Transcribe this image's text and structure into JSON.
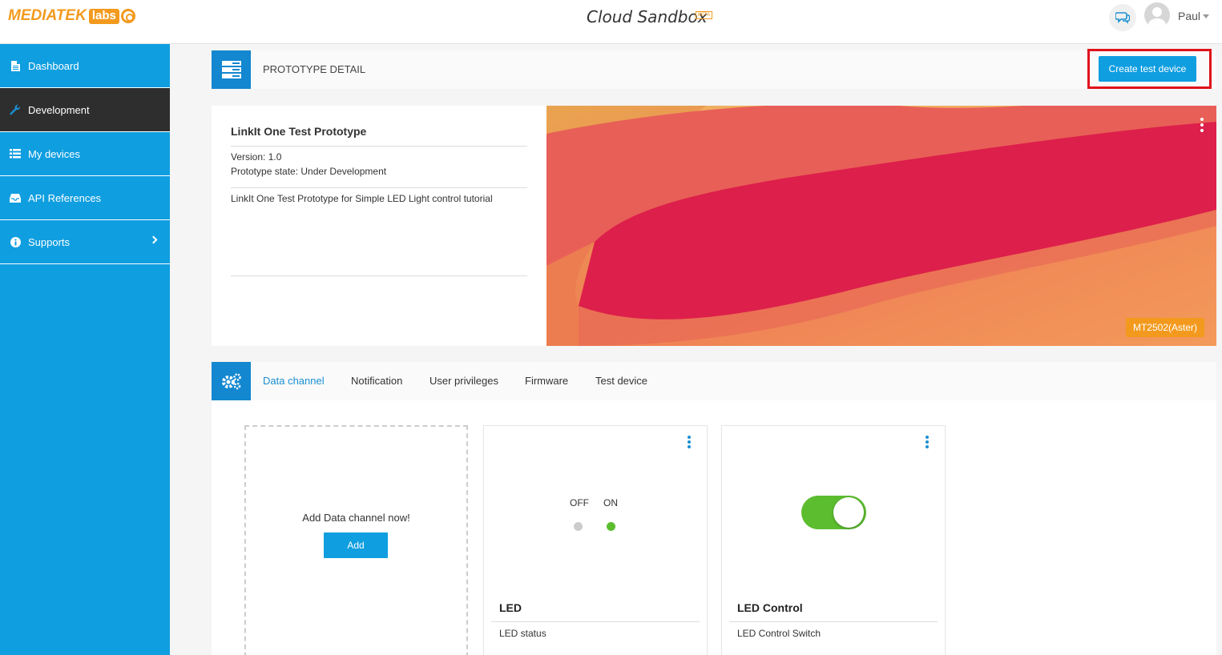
{
  "topbar": {
    "logo_main": "MEDIATEK",
    "logo_labs": "labs",
    "app_title": "Cloud Sandbox",
    "beta_badge": "BETA",
    "username": "Paul"
  },
  "sidebar": {
    "items": [
      {
        "label": "Dashboard",
        "icon": "document-icon"
      },
      {
        "label": "Development",
        "icon": "wrench-icon",
        "active": true
      },
      {
        "label": "My devices",
        "icon": "list-icon"
      },
      {
        "label": "API References",
        "icon": "inbox-icon"
      },
      {
        "label": "Supports",
        "icon": "info-icon"
      }
    ]
  },
  "header": {
    "title": "PROTOTYPE DETAIL",
    "create_button": "Create test device"
  },
  "prototype": {
    "name": "LinkIt One Test Prototype",
    "version": "Version: 1.0",
    "state": "Prototype state: Under Development",
    "description": "LinkIt One Test Prototype for Simple LED Light control tutorial",
    "chip": "MT2502(Aster)"
  },
  "tabs": [
    {
      "label": "Data channel",
      "active": true
    },
    {
      "label": "Notification"
    },
    {
      "label": "User privileges"
    },
    {
      "label": "Firmware"
    },
    {
      "label": "Test device"
    }
  ],
  "channels": {
    "add_prompt": "Add Data channel now!",
    "add_button": "Add",
    "led": {
      "title": "LED",
      "description": "LED status",
      "off_label": "OFF",
      "on_label": "ON",
      "state": "on"
    },
    "led_control": {
      "title": "LED Control",
      "description": "LED Control Switch",
      "switch_on": true
    }
  },
  "colors": {
    "sidebar": "#0f9ee0",
    "active_nav": "#2e2e2e",
    "brand_orange": "#f39a1e",
    "highlight": "#e0121b",
    "led_on": "#5cbd2f",
    "led_off": "#cccccc"
  }
}
